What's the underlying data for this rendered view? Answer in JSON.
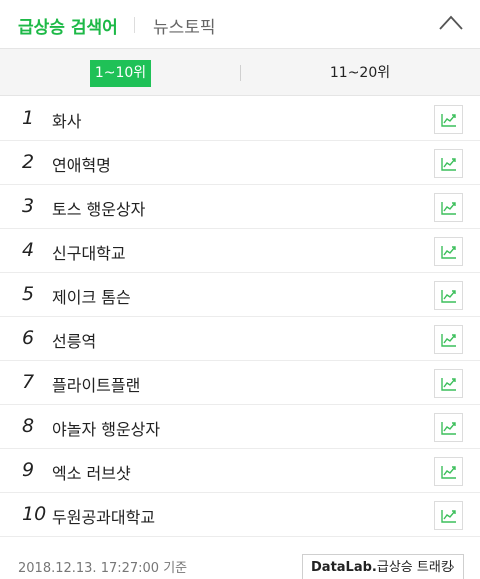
{
  "header": {
    "tab_main": "급상승 검색어",
    "tab_news": "뉴스토픽"
  },
  "range": {
    "active": "1~10위",
    "other": "11~20위"
  },
  "items": [
    {
      "rank": "1",
      "keyword": "화사"
    },
    {
      "rank": "2",
      "keyword": "연애혁명"
    },
    {
      "rank": "3",
      "keyword": "토스 행운상자"
    },
    {
      "rank": "4",
      "keyword": "신구대학교"
    },
    {
      "rank": "5",
      "keyword": "제이크 톰슨"
    },
    {
      "rank": "6",
      "keyword": "선릉역"
    },
    {
      "rank": "7",
      "keyword": "플라이트플랜"
    },
    {
      "rank": "8",
      "keyword": "야놀자 행운상자"
    },
    {
      "rank": "9",
      "keyword": "엑소 러브샷"
    },
    {
      "rank": "10",
      "keyword": "두원공과대학교"
    }
  ],
  "footer": {
    "timestamp": "2018.12.13. 17:27:00 기준",
    "datalab_brand": "DataLab.",
    "datalab_label": "급상승 트래킹",
    "datalab_arrow": "›"
  },
  "colors": {
    "accent": "#1db947",
    "active_bg": "#1fc157",
    "trend_icon": "#3cbf5b"
  }
}
